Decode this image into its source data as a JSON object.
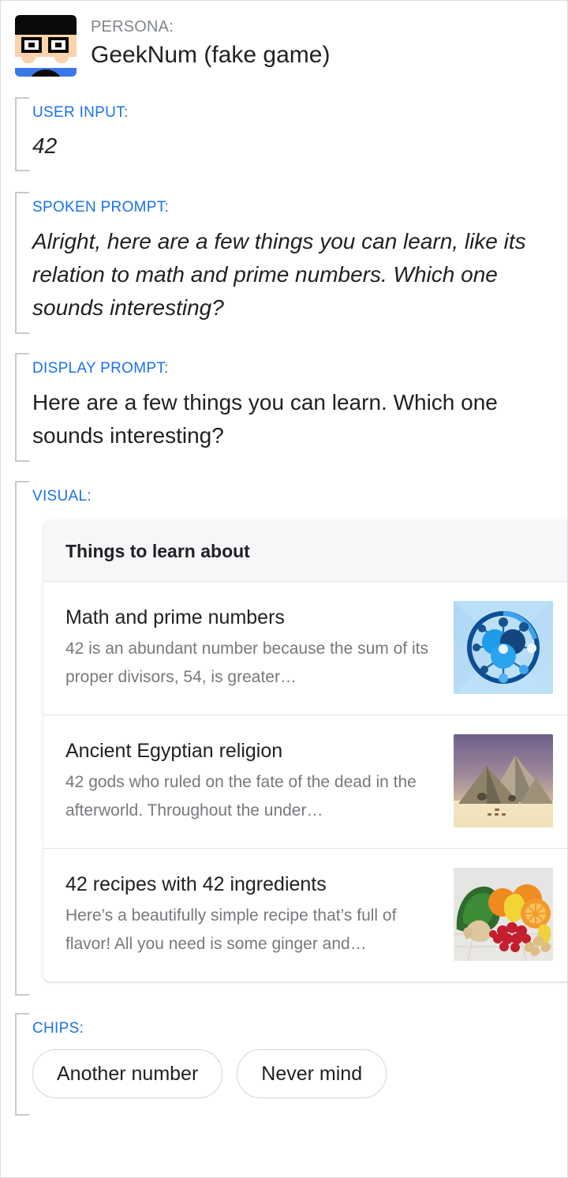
{
  "persona": {
    "label": "PERSONA:",
    "name": "GeekNum (fake game)",
    "avatar_icon": "geek-face-avatar"
  },
  "sections": {
    "user_input": {
      "label": "USER INPUT:",
      "value": "42"
    },
    "spoken_prompt": {
      "label": "SPOKEN PROMPT:",
      "text": "Alright, here are a few things you can learn, like its relation to math and prime numbers. Which one sounds interesting?"
    },
    "display_prompt": {
      "label": "DISPLAY PROMPT:",
      "text": "Here are a few things you can learn. Which one sounds interesting?"
    },
    "visual": {
      "label": "VISUAL:"
    },
    "chips": {
      "label": "CHIPS:"
    }
  },
  "card": {
    "header": "Things to learn about",
    "items": [
      {
        "title": "Math and prime numbers",
        "description": "42 is an abundant number because the sum of its proper divisors, 54, is greater…",
        "thumbnail": "network-node-diagram-icon"
      },
      {
        "title": "Ancient Egyptian religion",
        "description": "42 gods who ruled on the fate of the dead in the afterworld. Throughout the under…",
        "thumbnail": "pyramids-photo"
      },
      {
        "title": "42 recipes with 42 ingredients",
        "description": "Here’s a beautifully simple recipe that’s full of flavor! All you need is some ginger and…",
        "thumbnail": "fruits-vegetables-photo"
      }
    ]
  },
  "chips": [
    {
      "label": "Another number"
    },
    {
      "label": "Never mind"
    }
  ],
  "colors": {
    "section_label": "#1a73e8",
    "persona_label": "#80868b",
    "body_text": "#202124",
    "muted_text": "#76797d",
    "bracket": "#c8cacd",
    "card_header_bg": "#f6f7f8",
    "page_border": "#dcdde1"
  }
}
